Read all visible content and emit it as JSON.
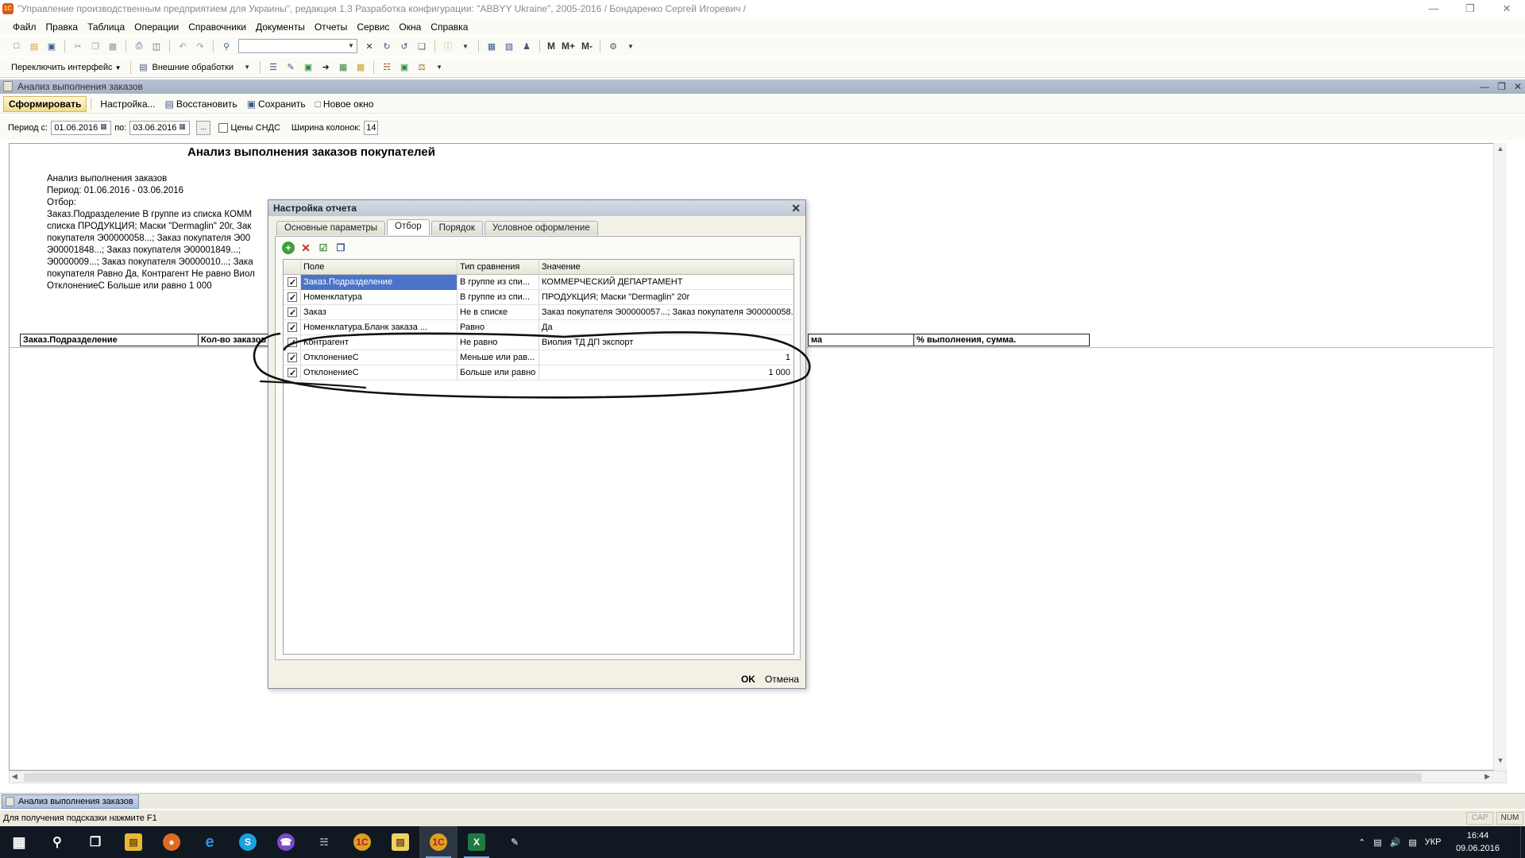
{
  "window": {
    "title": "\"Управление производственным предприятием для Украины\", редакция 1.3 Разработка конфигурации: \"ABBYY Ukraine\", 2005-2016 / Бондаренко Сергей Игоревич /"
  },
  "menu": [
    "Файл",
    "Правка",
    "Таблица",
    "Операции",
    "Справочники",
    "Документы",
    "Отчеты",
    "Сервис",
    "Окна",
    "Справка"
  ],
  "toolbar2": {
    "switch_interface": "Переключить интерфейс",
    "external": "Внешние обработки"
  },
  "toolbar1": {
    "m": "M",
    "m_plus": "M+",
    "m_minus": "M-"
  },
  "doc": {
    "title": "Анализ выполнения заказов",
    "commands": {
      "generate": "Сформировать",
      "settings": "Настройка...",
      "restore": "Восстановить",
      "save": "Сохранить",
      "new_window": "Новое окно"
    },
    "period": {
      "from_label": "Период с:",
      "from": "01.06.2016",
      "to_label": "по:",
      "to": "03.06.2016",
      "ellipsis": "...",
      "vat_label": "Цены СНДС",
      "width_label": "Ширина колонок:",
      "width": "14"
    }
  },
  "report": {
    "title": "Анализ выполнения заказов покупателей",
    "lines": [
      "Анализ выполнения заказов",
      "Период: 01.06.2016 - 03.06.2016",
      "Отбор:",
      " Заказ.Подразделение В группе из списка КОММ",
      "списка ПРОДУКЦИЯ; Маски \"Dermaglin\" 20г, Зак",
      "покупателя Э00000058...; Заказ покупателя Э00",
      "Э00001848...; Заказ покупателя Э00001849...;",
      "Э0000009...; Заказ покупателя Э0000010...; Зака",
      "покупателя Равно Да, Контрагент Не равно Виол",
      "ОтклонениеС Больше или равно 1 000"
    ],
    "columns": [
      "Заказ.Подразделение",
      "Кол-во заказов",
      "ма",
      "% выполнения, сумма."
    ]
  },
  "dialog": {
    "title": "Настройка отчета",
    "tabs": [
      "Основные параметры",
      "Отбор",
      "Порядок",
      "Условное оформление"
    ],
    "active_tab": "Отбор",
    "headers": {
      "field": "Поле",
      "type": "Тип сравнения",
      "value": "Значение"
    },
    "rows": [
      {
        "checked": true,
        "field": "Заказ.Подразделение",
        "type": "В группе из спи...",
        "value": "КОММЕРЧЕСКИЙ ДЕПАРТАМЕНТ"
      },
      {
        "checked": true,
        "field": "Номенклатура",
        "type": "В группе из спи...",
        "value": "ПРОДУКЦИЯ; Маски \"Dermaglin\" 20г"
      },
      {
        "checked": true,
        "field": "Заказ",
        "type": "Не в списке",
        "value": "Заказ покупателя Э00000057...; Заказ покупателя Э00000058......"
      },
      {
        "checked": true,
        "field": "Номенклатура.Бланк заказа ...",
        "type": "Равно",
        "value": "Да"
      },
      {
        "checked": true,
        "field": "Контрагент",
        "type": "Не равно",
        "value": "Виолия ТД ДП экспорт"
      },
      {
        "checked": true,
        "field": "ОтклонениеС",
        "type": "Меньше или рав...",
        "value": "1"
      },
      {
        "checked": true,
        "field": "ОтклонениеС",
        "type": "Больше или равно",
        "value": "1 000"
      }
    ],
    "ok": "OK",
    "cancel": "Отмена"
  },
  "windows_bar": {
    "tab": "Анализ выполнения заказов"
  },
  "status": {
    "hint": "Для получения подсказки нажмите F1",
    "cap": "CAP",
    "num": "NUM"
  },
  "taskbar": {
    "lang": "УКР",
    "time": "16:44",
    "date": "09.06.2016"
  }
}
